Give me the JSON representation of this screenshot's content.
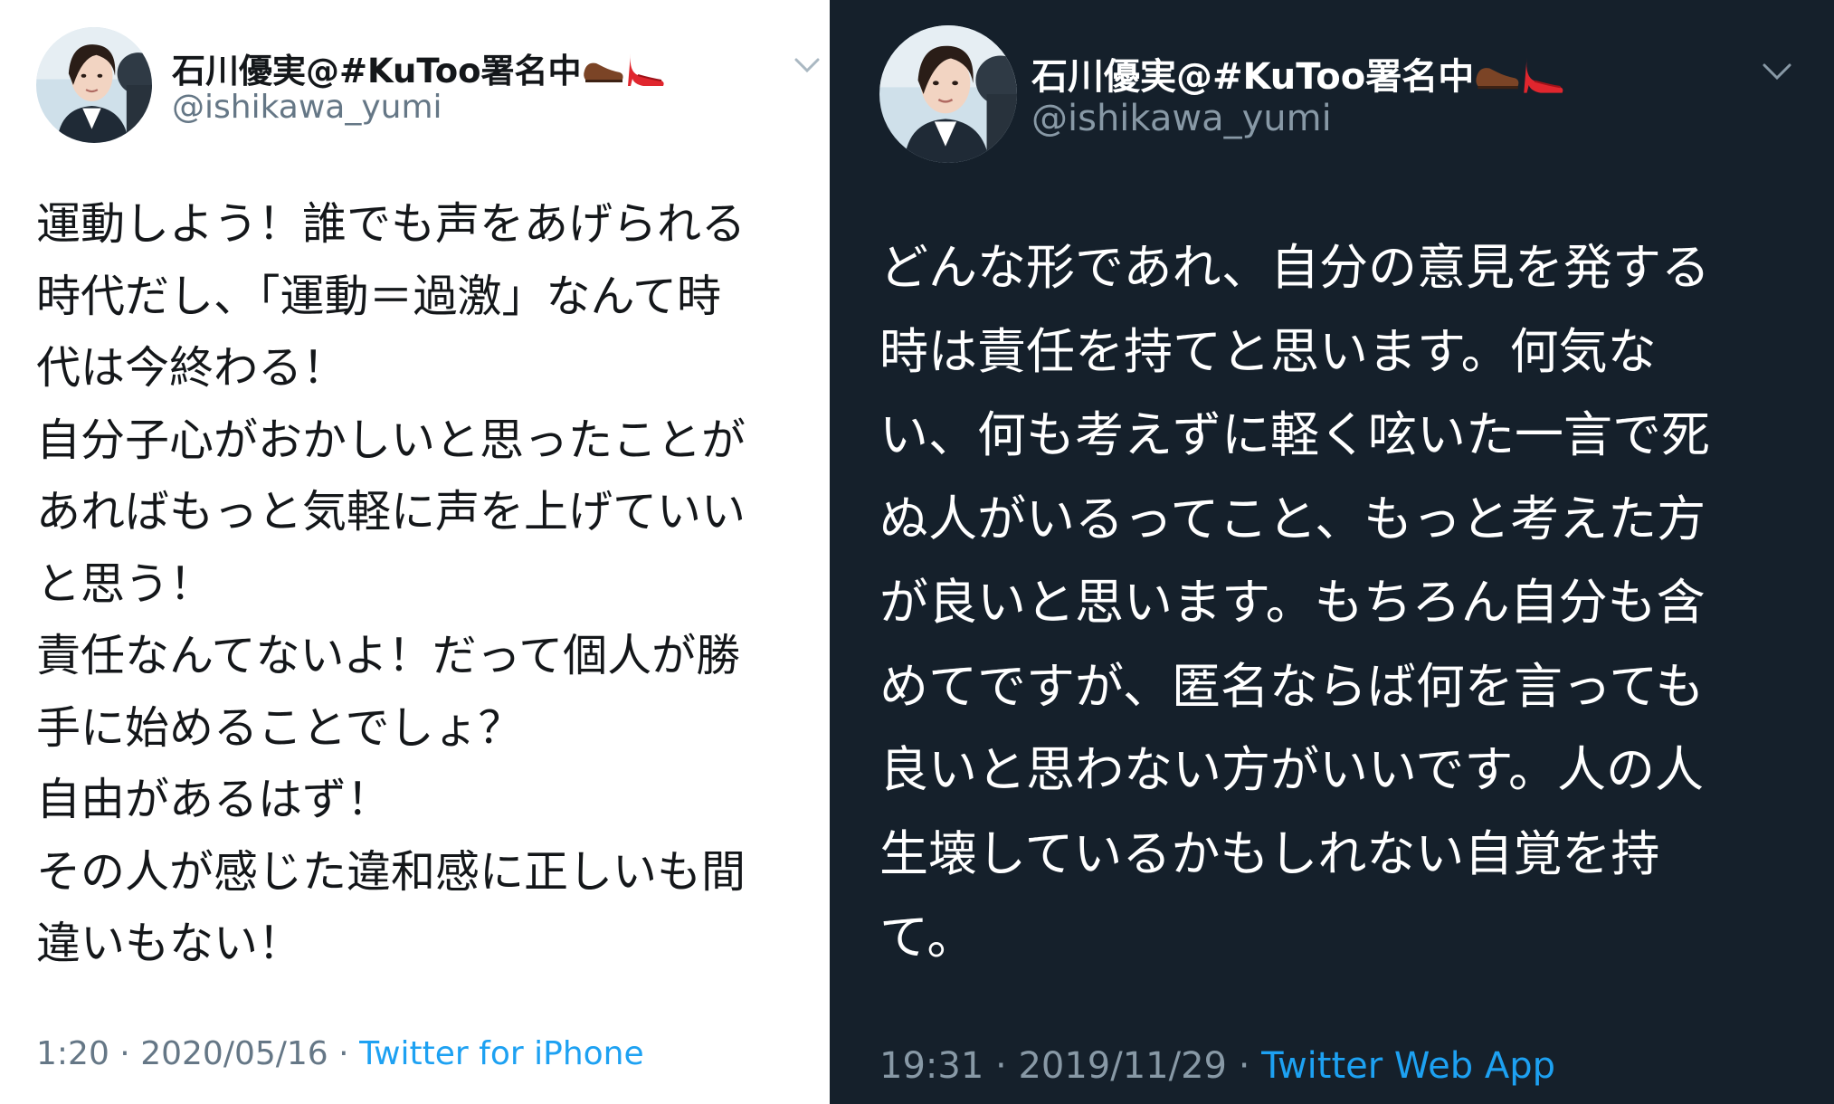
{
  "colors": {
    "light_bg": "#ffffff",
    "dark_bg": "#15202b",
    "link": "#1da1f2"
  },
  "tweets": [
    {
      "display_name": "石川優実@#KuToo署名中",
      "handle": "@ishikawa_yumi",
      "name_emojis": [
        "brown-shoe-icon",
        "high-heel-icon"
      ],
      "body_lines": [
        "運動しよう！誰でも声をあげられる",
        "時代だし、「運動＝過激」なんて時",
        "代は今終わる！",
        "自分子心がおかしいと思ったことが",
        "あればもっと気軽に声を上げていい",
        "と思う！",
        "責任なんてないよ！だって個人が勝",
        "手に始めることでしょ？",
        "自由があるはず！",
        "その人が感じた違和感に正しいも間",
        "違いもない！"
      ],
      "time": "1:20",
      "date": "2020/05/16",
      "separator": "·",
      "source": "Twitter for iPhone"
    },
    {
      "display_name": "石川優実@#KuToo署名中",
      "handle": "@ishikawa_yumi",
      "name_emojis": [
        "brown-shoe-icon",
        "high-heel-icon"
      ],
      "body_lines": [
        "どんな形であれ、自分の意見を発する",
        "時は責任を持てと思います。何気な",
        "い、何も考えずに軽く呟いた一言で死",
        "ぬ人がいるってこと、もっと考えた方",
        "が良いと思います。もちろん自分も含",
        "めてですが、匿名ならば何を言っても",
        "良いと思わない方がいいです。人の人",
        "生壊しているかもしれない自覚を持",
        "て。"
      ],
      "time": "19:31",
      "date": "2019/11/29",
      "separator": "·",
      "source": "Twitter Web App"
    }
  ]
}
